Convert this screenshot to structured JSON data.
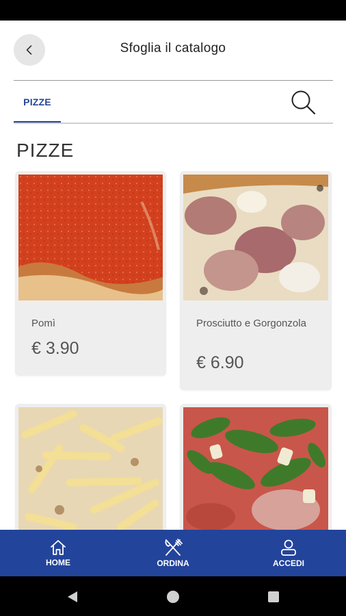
{
  "header": {
    "title": "Sfoglia il catalogo"
  },
  "tabs": [
    {
      "label": "PIZZE"
    }
  ],
  "section": {
    "title": "PIZZE"
  },
  "products": [
    {
      "name": "Pomì",
      "price": "€ 3.90"
    },
    {
      "name": "Prosciutto e Gorgonzola",
      "price": "€ 6.90"
    },
    {
      "name": "",
      "price": ""
    },
    {
      "name": "",
      "price": ""
    }
  ],
  "bottom_nav": [
    {
      "label": "HOME",
      "icon": "home-icon"
    },
    {
      "label": "ORDINA",
      "icon": "fork-knife-icon"
    },
    {
      "label": "ACCEDI",
      "icon": "user-icon"
    }
  ],
  "colors": {
    "accent": "#23449b",
    "card_bg": "#eeeeee"
  }
}
